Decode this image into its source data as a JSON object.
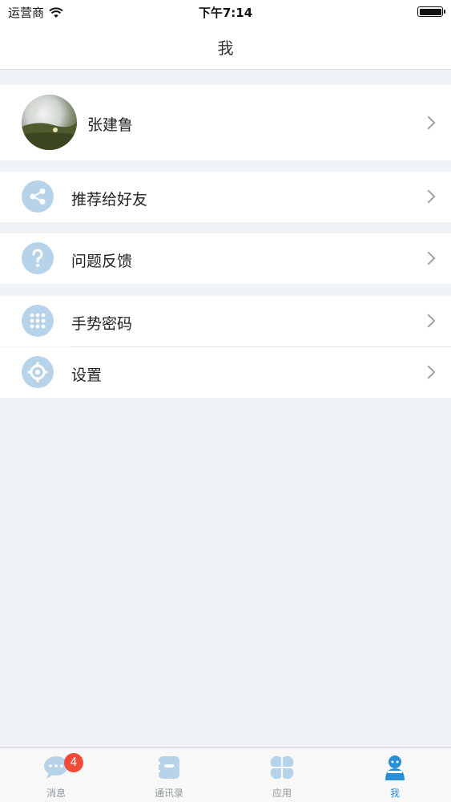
{
  "status_bar": {
    "carrier": "运营商",
    "time": "下午7:14"
  },
  "nav": {
    "title": "我"
  },
  "profile": {
    "name": "张建鲁"
  },
  "menu": {
    "share": {
      "label": "推荐给好友",
      "icon": "share-icon"
    },
    "feedback": {
      "label": "问题反馈",
      "icon": "question-icon"
    },
    "gesture": {
      "label": "手势密码",
      "icon": "keypad-grid-icon"
    },
    "settings": {
      "label": "设置",
      "icon": "gear-icon"
    }
  },
  "tabs": [
    {
      "label": "消息",
      "icon": "chat-bubble-icon",
      "badge": "4"
    },
    {
      "label": "通讯录",
      "icon": "contacts-book-icon"
    },
    {
      "label": "应用",
      "icon": "apps-clover-icon"
    },
    {
      "label": "我",
      "icon": "person-icon",
      "active": true
    }
  ],
  "colors": {
    "background": "#eff3f6",
    "icon_fill": "#b7d3ea",
    "tab_active": "#2b8fd6",
    "badge": "#f04a3a"
  }
}
